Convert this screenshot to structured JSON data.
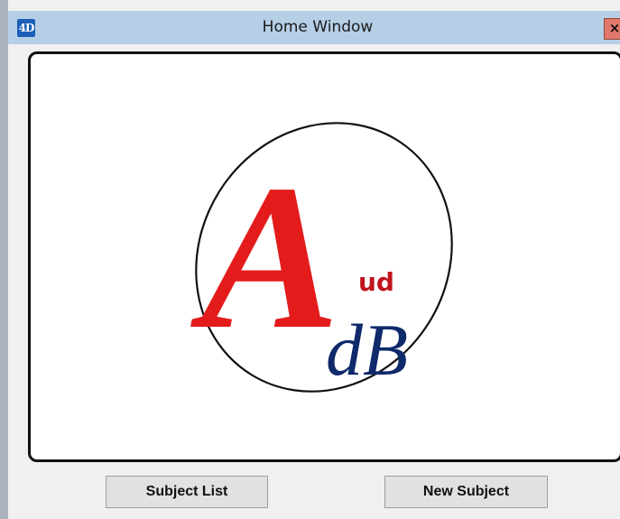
{
  "window": {
    "title": "Home Window",
    "app_icon_text": "4D",
    "close_label": "×"
  },
  "logo": {
    "letter_a": "A",
    "text_ud": "ud",
    "text_db": "dB",
    "colors": {
      "letter_a": "#e31b1b",
      "text_ud": "#c0151e",
      "text_db": "#0f2a6b",
      "ellipse": "#111111"
    }
  },
  "buttons": {
    "subject_list": "Subject List",
    "new_subject": "New Subject"
  }
}
